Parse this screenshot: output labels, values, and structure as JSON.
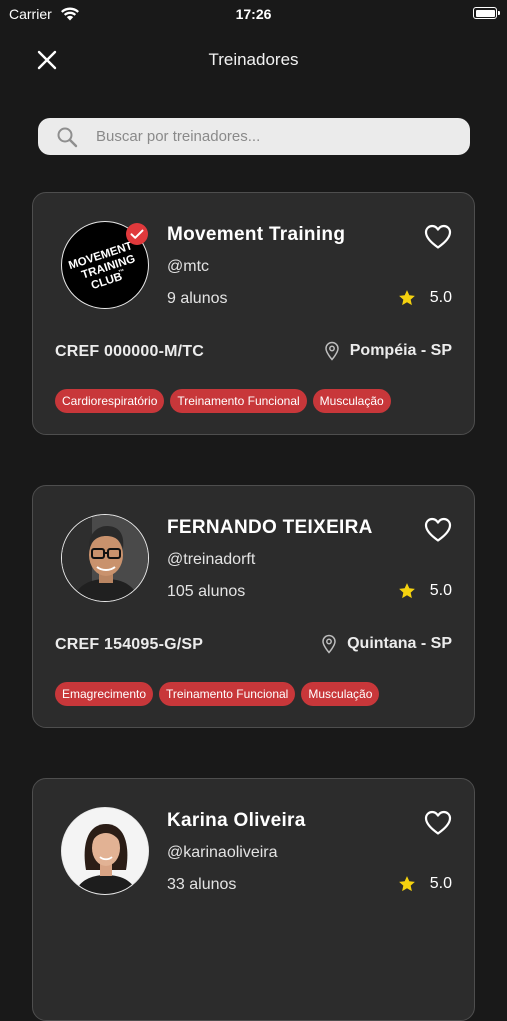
{
  "status_bar": {
    "carrier": "Carrier",
    "time": "17:26"
  },
  "nav": {
    "title": "Treinadores",
    "close_icon": "close-icon"
  },
  "search": {
    "placeholder": "Buscar por treinadores...",
    "value": ""
  },
  "trainers": [
    {
      "name": "Movement Training",
      "handle": "@mtc",
      "students": "9 alunos",
      "rating": "5.0",
      "cref": "CREF 000000-M/TC",
      "location": "Pompéia - SP",
      "verified": true,
      "avatar_text": [
        "MOVEMENT",
        "TRAINING",
        "CLUB"
      ],
      "avatar_mark": "™",
      "tags": [
        "Cardiorespiratório",
        "Treinamento Funcional",
        "Musculação"
      ]
    },
    {
      "name": "FERNANDO TEIXEIRA",
      "handle": "@treinadorft",
      "students": "105 alunos",
      "rating": "5.0",
      "cref": "CREF 154095-G/SP",
      "location": "Quintana - SP",
      "verified": false,
      "tags": [
        "Emagrecimento",
        "Treinamento Funcional",
        "Musculação"
      ]
    },
    {
      "name": "Karina Oliveira",
      "handle": "@karinaoliveira",
      "students": "33 alunos",
      "rating": "5.0",
      "verified": false
    }
  ],
  "colors": {
    "background": "#191919",
    "card": "#2c2c2c",
    "tag": "#c8373a",
    "star": "#f5d20f",
    "verified": "#e0393c"
  }
}
